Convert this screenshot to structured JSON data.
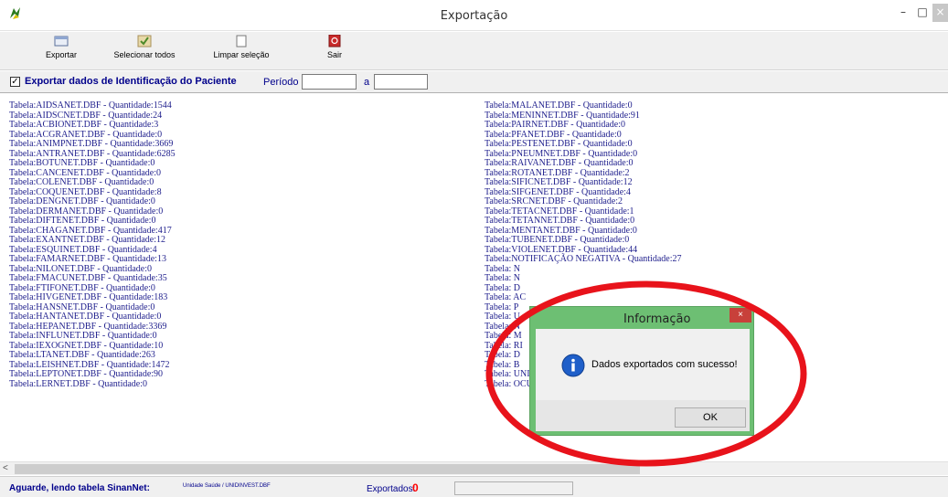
{
  "window": {
    "title": "Exportação",
    "minimize_glyph": "–",
    "maximize_glyph": "□",
    "close_glyph": "×"
  },
  "toolbar": {
    "exportar": "Exportar",
    "selecionar_todos": "Selecionar todos",
    "limpar_selecao": "Limpar seleção",
    "sair": "Sair"
  },
  "options": {
    "export_id_label": "Exportar dados de Identificação do Paciente",
    "checkbox_mark": "✓",
    "periodo_label": "Período",
    "periodo_from": "",
    "a_label": "a",
    "periodo_to": ""
  },
  "log": {
    "left": [
      "Tabela:AIDSANET.DBF - Quantidade:1544",
      "Tabela:AIDSCNET.DBF - Quantidade:24",
      "Tabela:ACBIONET.DBF - Quantidade:3",
      "Tabela:ACGRANET.DBF - Quantidade:0",
      "Tabela:ANIMPNET.DBF - Quantidade:3669",
      "Tabela:ANTRANET.DBF - Quantidade:6285",
      "Tabela:BOTUNET.DBF - Quantidade:0",
      "Tabela:CANCENET.DBF - Quantidade:0",
      "Tabela:COLENET.DBF - Quantidade:0",
      "Tabela:COQUENET.DBF - Quantidade:8",
      "Tabela:DENGNET.DBF - Quantidade:0",
      "Tabela:DERMANET.DBF - Quantidade:0",
      "Tabela:DIFTENET.DBF - Quantidade:0",
      "Tabela:CHAGANET.DBF - Quantidade:417",
      "Tabela:EXANTNET.DBF - Quantidade:12",
      "Tabela:ESQUINET.DBF - Quantidade:4",
      "Tabela:FAMARNET.DBF - Quantidade:13",
      "Tabela:NILONET.DBF - Quantidade:0",
      "Tabela:FMACUNET.DBF - Quantidade:35",
      "Tabela:FTIFONET.DBF - Quantidade:0",
      "Tabela:HIVGENET.DBF - Quantidade:183",
      "Tabela:HANSNET.DBF - Quantidade:0",
      "Tabela:HANTANET.DBF - Quantidade:0",
      "Tabela:HEPANET.DBF - Quantidade:3369",
      "Tabela:INFLUNET.DBF - Quantidade:0",
      "Tabela:IEXOGNET.DBF - Quantidade:10",
      "Tabela:LTANET.DBF - Quantidade:263",
      "Tabela:LEISHNET.DBF - Quantidade:1472",
      "Tabela:LEPTONET.DBF - Quantidade:90",
      "Tabela:LERNET.DBF - Quantidade:0"
    ],
    "right": [
      "Tabela:MALANET.DBF - Quantidade:0",
      "Tabela:MENINNET.DBF - Quantidade:91",
      "Tabela:PAIRNET.DBF - Quantidade:0",
      "Tabela:PFANET.DBF - Quantidade:0",
      "Tabela:PESTENET.DBF - Quantidade:0",
      "Tabela:PNEUMNET.DBF - Quantidade:0",
      "Tabela:RAIVANET.DBF - Quantidade:0",
      "Tabela:ROTANET.DBF - Quantidade:2",
      "Tabela:SIFICNET.DBF - Quantidade:12",
      "Tabela:SIFGENET.DBF - Quantidade:4",
      "Tabela:SRCNET.DBF - Quantidade:2",
      "Tabela:TETACNET.DBF - Quantidade:1",
      "Tabela:TETANNET.DBF - Quantidade:0",
      "Tabela:MENTANET.DBF - Quantidade:0",
      "Tabela:TUBENET.DBF - Quantidade:0",
      "Tabela:VIOLENET.DBF - Quantidade:44",
      "Tabela:NOTIFICAÇÃO NEGATIVA - Quantidade:27",
      "Tabela: N",
      "Tabela: N",
      "Tabela: D",
      "Tabela: AC",
      "Tabela: P",
      "Tabela: U",
      "Tabela: N",
      "Tabela: M",
      "Tabela: RI",
      "Tabela: D",
      "Tabela: B",
      "Tabela: UNIDADE.DBF - Quantidade:11",
      "Tabela: OCUPAÇÃO - Quantidade:2598"
    ]
  },
  "status": {
    "main": "Aguarde, lendo tabela SinanNet:",
    "sub": "Unidade Saúde / UNIDINVEST.DBF",
    "exportados_label": "Exportados:",
    "exportados_count": "0"
  },
  "dialog": {
    "title": "Informação",
    "close_glyph": "×",
    "message": "Dados exportados com sucesso!",
    "ok": "OK"
  },
  "colors": {
    "text_blue": "#00008b",
    "dialog_frame": "#6dbf73",
    "annotation_red": "#e8131b",
    "count_red": "#ff0000"
  }
}
